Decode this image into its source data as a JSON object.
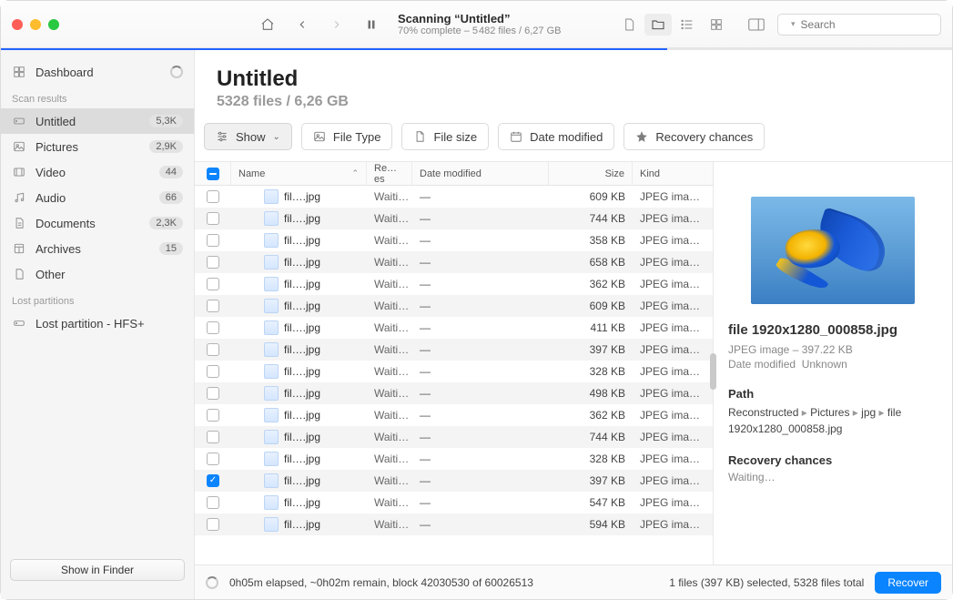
{
  "toolbar": {
    "title": "Scanning “Untitled”",
    "subtitle": "70% complete – 5 482 files / 6,27 GB",
    "progress_percent": 70,
    "search_placeholder": "Search"
  },
  "sidebar": {
    "dashboard_label": "Dashboard",
    "scan_results_header": "Scan results",
    "items": [
      {
        "label": "Untitled",
        "badge": "5,3K",
        "selected": true,
        "icon": "drive"
      },
      {
        "label": "Pictures",
        "badge": "2,9K",
        "selected": false,
        "icon": "photo"
      },
      {
        "label": "Video",
        "badge": "44",
        "selected": false,
        "icon": "video"
      },
      {
        "label": "Audio",
        "badge": "66",
        "selected": false,
        "icon": "audio"
      },
      {
        "label": "Documents",
        "badge": "2,3K",
        "selected": false,
        "icon": "doc"
      },
      {
        "label": "Archives",
        "badge": "15",
        "selected": false,
        "icon": "archive"
      },
      {
        "label": "Other",
        "badge": "",
        "selected": false,
        "icon": "other"
      }
    ],
    "lost_header": "Lost partitions",
    "lost_items": [
      {
        "label": "Lost partition - HFS+"
      }
    ],
    "show_in_finder": "Show in Finder"
  },
  "header": {
    "title": "Untitled",
    "subtitle": "5328 files / 6,26 GB"
  },
  "filters": {
    "show": "Show",
    "file_type": "File Type",
    "file_size": "File size",
    "date_modified": "Date modified",
    "recovery_chances": "Recovery chances"
  },
  "columns": {
    "name": "Name",
    "res": "Re…es",
    "date": "Date modified",
    "size": "Size",
    "kind": "Kind"
  },
  "rows": [
    {
      "checked": false,
      "name": "fil….jpg",
      "res": "Waiti…",
      "date": "—",
      "size": "609 KB",
      "kind": "JPEG ima…"
    },
    {
      "checked": false,
      "name": "fil….jpg",
      "res": "Waiti…",
      "date": "—",
      "size": "744 KB",
      "kind": "JPEG ima…"
    },
    {
      "checked": false,
      "name": "fil….jpg",
      "res": "Waiti…",
      "date": "—",
      "size": "358 KB",
      "kind": "JPEG ima…"
    },
    {
      "checked": false,
      "name": "fil….jpg",
      "res": "Waiti…",
      "date": "—",
      "size": "658 KB",
      "kind": "JPEG ima…"
    },
    {
      "checked": false,
      "name": "fil….jpg",
      "res": "Waiti…",
      "date": "—",
      "size": "362 KB",
      "kind": "JPEG ima…"
    },
    {
      "checked": false,
      "name": "fil….jpg",
      "res": "Waiti…",
      "date": "—",
      "size": "609 KB",
      "kind": "JPEG ima…"
    },
    {
      "checked": false,
      "name": "fil….jpg",
      "res": "Waiti…",
      "date": "—",
      "size": "411 KB",
      "kind": "JPEG ima…"
    },
    {
      "checked": false,
      "name": "fil….jpg",
      "res": "Waiti…",
      "date": "—",
      "size": "397 KB",
      "kind": "JPEG ima…"
    },
    {
      "checked": false,
      "name": "fil….jpg",
      "res": "Waiti…",
      "date": "—",
      "size": "328 KB",
      "kind": "JPEG ima…"
    },
    {
      "checked": false,
      "name": "fil….jpg",
      "res": "Waiti…",
      "date": "—",
      "size": "498 KB",
      "kind": "JPEG ima…"
    },
    {
      "checked": false,
      "name": "fil….jpg",
      "res": "Waiti…",
      "date": "—",
      "size": "362 KB",
      "kind": "JPEG ima…"
    },
    {
      "checked": false,
      "name": "fil….jpg",
      "res": "Waiti…",
      "date": "—",
      "size": "744 KB",
      "kind": "JPEG ima…"
    },
    {
      "checked": false,
      "name": "fil….jpg",
      "res": "Waiti…",
      "date": "—",
      "size": "328 KB",
      "kind": "JPEG ima…"
    },
    {
      "checked": true,
      "name": "fil….jpg",
      "res": "Waiti…",
      "date": "—",
      "size": "397 KB",
      "kind": "JPEG ima…"
    },
    {
      "checked": false,
      "name": "fil….jpg",
      "res": "Waiti…",
      "date": "—",
      "size": "547 KB",
      "kind": "JPEG ima…"
    },
    {
      "checked": false,
      "name": "fil….jpg",
      "res": "Waiti…",
      "date": "—",
      "size": "594 KB",
      "kind": "JPEG ima…"
    }
  ],
  "inspector": {
    "filename": "file 1920x1280_000858.jpg",
    "meta": "JPEG image – 397.22 KB",
    "date_label": "Date modified",
    "date_value": "Unknown",
    "path_label": "Path",
    "path_parts": [
      "Reconstructed",
      "Pictures",
      "jpg",
      "file 1920x1280_000858.jpg"
    ],
    "rc_label": "Recovery chances",
    "rc_value": "Waiting…"
  },
  "status": {
    "left": "0h05m elapsed, ~0h02m remain, block 42030530 of 60026513",
    "right": "1 files (397 KB) selected, 5328 files total",
    "recover": "Recover"
  }
}
